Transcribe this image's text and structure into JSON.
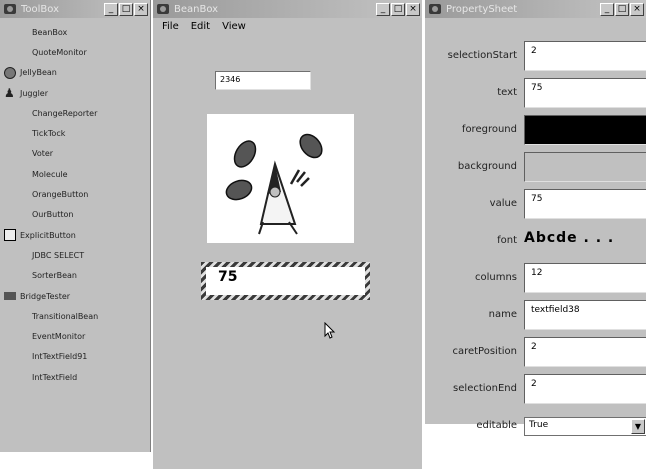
{
  "toolbox": {
    "title": "ToolBox",
    "items": [
      {
        "label": "BeanBox",
        "icon": ""
      },
      {
        "label": "QuoteMonitor",
        "icon": ""
      },
      {
        "label": "JellyBean",
        "icon": "jellybean-icon"
      },
      {
        "label": "Juggler",
        "icon": "juggler-icon"
      },
      {
        "label": "ChangeReporter",
        "icon": ""
      },
      {
        "label": "TickTock",
        "icon": ""
      },
      {
        "label": "Voter",
        "icon": ""
      },
      {
        "label": "Molecule",
        "icon": ""
      },
      {
        "label": "OrangeButton",
        "icon": ""
      },
      {
        "label": "OurButton",
        "icon": ""
      },
      {
        "label": "ExplicitButton",
        "icon": "explicit-button-icon"
      },
      {
        "label": "JDBC SELECT",
        "icon": ""
      },
      {
        "label": "SorterBean",
        "icon": ""
      },
      {
        "label": "BridgeTester",
        "icon": "bridge-icon"
      },
      {
        "label": "TransitionalBean",
        "icon": ""
      },
      {
        "label": "EventMonitor",
        "icon": ""
      },
      {
        "label": "IntTextField91",
        "icon": ""
      },
      {
        "label": "IntTextField",
        "icon": ""
      }
    ]
  },
  "beanbox": {
    "title": "BeanBox",
    "menu": [
      "File",
      "Edit",
      "View"
    ],
    "input_value": "2346",
    "selected_field_value": "75"
  },
  "props": {
    "title": "PropertySheet",
    "rows": [
      {
        "label": "selectionStart",
        "value": "2",
        "kind": "text"
      },
      {
        "label": "text",
        "value": "75",
        "kind": "text"
      },
      {
        "label": "foreground",
        "value": "#000000",
        "kind": "color"
      },
      {
        "label": "background",
        "value": "#c0c0c0",
        "kind": "color"
      },
      {
        "label": "value",
        "value": "75",
        "kind": "text"
      },
      {
        "label": "font",
        "value": "Abcde . . .",
        "kind": "font"
      },
      {
        "label": "columns",
        "value": "12",
        "kind": "text"
      },
      {
        "label": "name",
        "value": "textfield38",
        "kind": "text"
      },
      {
        "label": "caretPosition",
        "value": "2",
        "kind": "text"
      },
      {
        "label": "selectionEnd",
        "value": "2",
        "kind": "text"
      },
      {
        "label": "editable",
        "value": "True",
        "kind": "select"
      }
    ]
  },
  "window_buttons": {
    "minimize": "_",
    "maximize": "□",
    "close": "×"
  }
}
